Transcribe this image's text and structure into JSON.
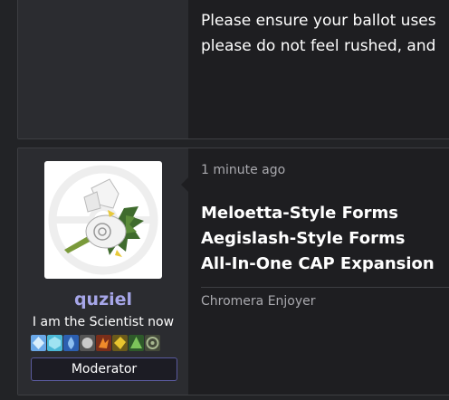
{
  "previous_post": {
    "text_lines": [
      "Please ensure your ballot uses",
      "please do not feel rushed, and"
    ]
  },
  "post": {
    "author": {
      "username": "quziel",
      "title": "I am the Scientist now",
      "role": "Moderator",
      "username_color": "#a6a6e8",
      "avatar_icon": "kartana-pokemon-avatar",
      "badges": [
        {
          "icon": "badge-1",
          "color": "#5fa8e0"
        },
        {
          "icon": "badge-2",
          "color": "#4bb8d6"
        },
        {
          "icon": "badge-3",
          "color": "#3c7fd0"
        },
        {
          "icon": "badge-4",
          "color": "#9a9a9a"
        },
        {
          "icon": "badge-5",
          "color": "#e07a2a"
        },
        {
          "icon": "badge-6",
          "color": "#d9b02e"
        },
        {
          "icon": "badge-7",
          "color": "#6ab04c"
        },
        {
          "icon": "badge-8",
          "color": "#8a9a7a"
        }
      ]
    },
    "timestamp": "1 minute ago",
    "lines": [
      "Meloetta-Style Forms",
      "Aegislash-Style Forms",
      "All-In-One CAP Expansion"
    ],
    "signature": "Chromera Enjoyer"
  }
}
